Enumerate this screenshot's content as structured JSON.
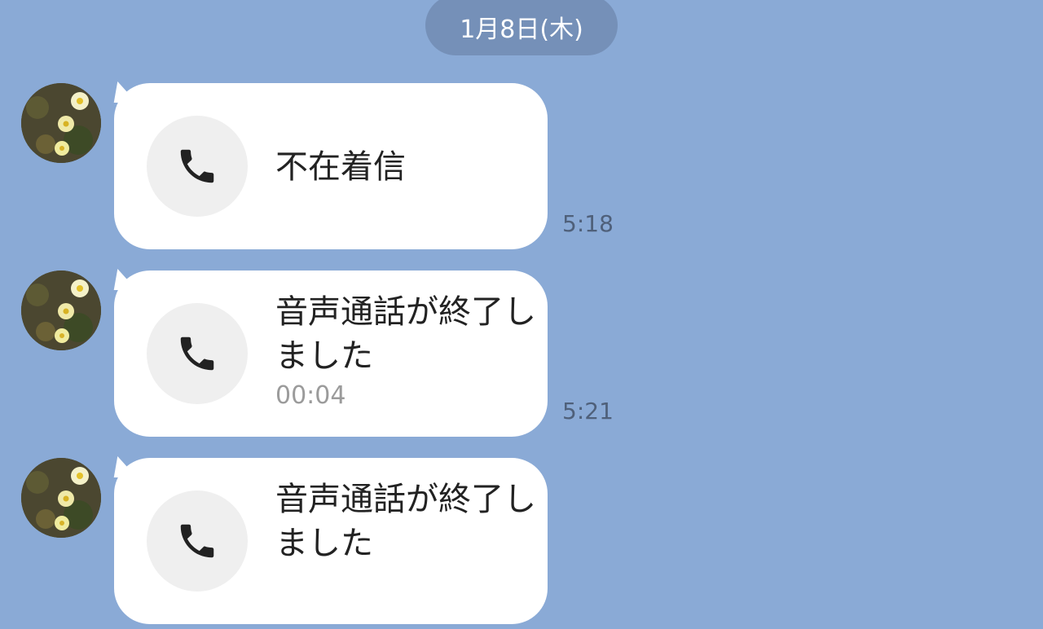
{
  "date_separator": "1月8日(木)",
  "messages": [
    {
      "icon": "phone-icon",
      "title": "不在着信",
      "duration": "",
      "time": "5:18"
    },
    {
      "icon": "phone-icon",
      "title": "音声通話が終了しました",
      "duration": "00:04",
      "time": "5:21"
    },
    {
      "icon": "phone-icon",
      "title": "音声通話が終了しました",
      "duration": "",
      "time": ""
    }
  ],
  "colors": {
    "background": "#8aaad6",
    "date_pill": "#7590b8",
    "bubble": "#ffffff",
    "call_circle": "#efefef",
    "timestamp": "#4f607a",
    "duration": "#9b9b9b"
  }
}
